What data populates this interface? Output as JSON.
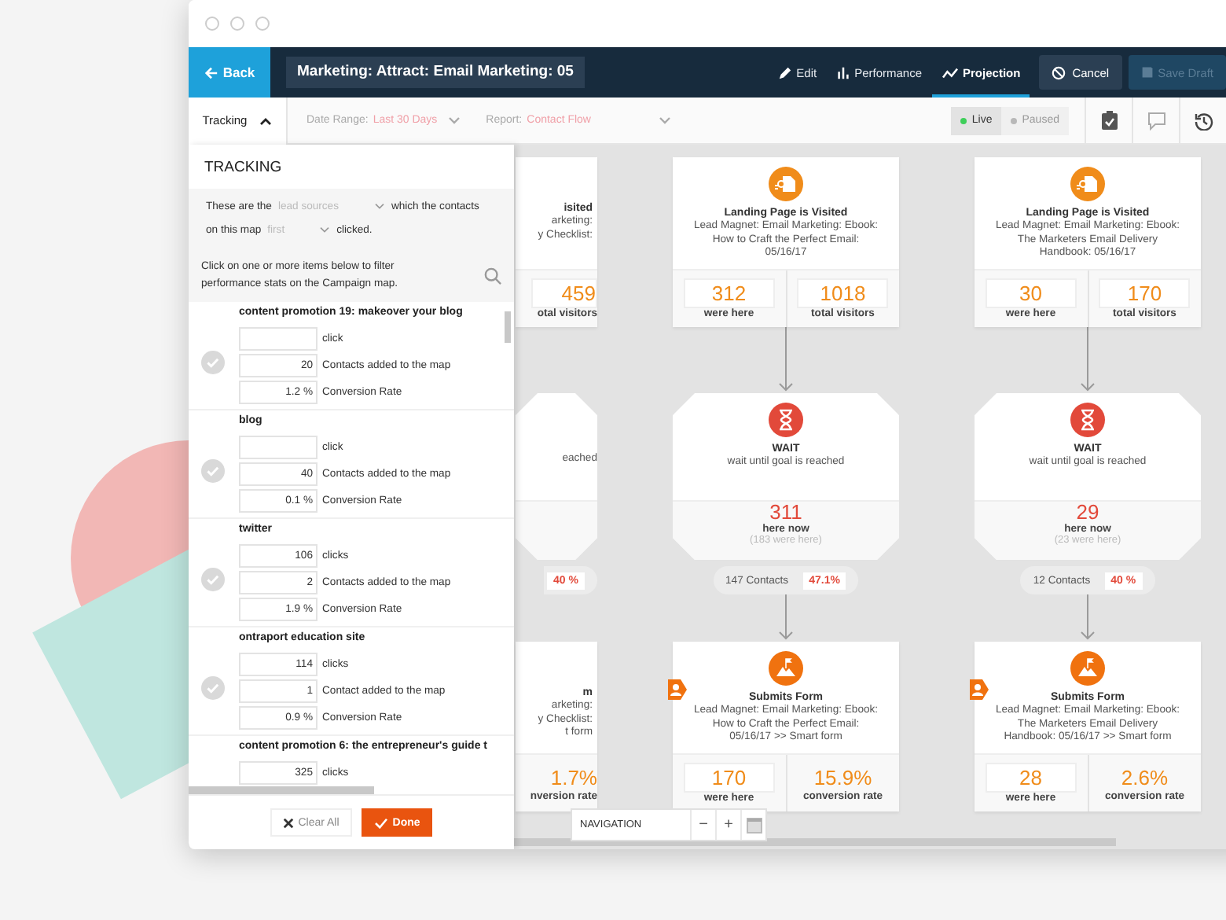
{
  "header": {
    "back": "Back",
    "title": "Marketing: Attract: Email Marketing: 05",
    "views": [
      {
        "kind": "edit",
        "label": "Edit",
        "selected": false
      },
      {
        "kind": "performance",
        "label": "Performance",
        "selected": false
      },
      {
        "kind": "projection",
        "label": "Projection",
        "selected": true
      }
    ],
    "cancel": "Cancel",
    "save_draft": {
      "label": "Save Draft",
      "disabled": true
    }
  },
  "toolbar": {
    "tracking": {
      "label": "Tracking",
      "expanded": true
    },
    "date_range": {
      "label": "Date Range:",
      "value": "Last 30 Days"
    },
    "report": {
      "label": "Report:",
      "value": "Contact Flow"
    },
    "modes": [
      {
        "kind": "live",
        "label": "Live",
        "selected": true
      },
      {
        "kind": "paused",
        "label": "Paused",
        "selected": false
      }
    ]
  },
  "tracking_panel": {
    "title": "TRACKING",
    "filter": {
      "text_1": "These are the",
      "source": "lead sources",
      "text_2": "which the contacts",
      "text_3": "on this map",
      "order": "first",
      "text_4": "clicked."
    },
    "hint": "Click on one or more items below to filter performance stats on the Campaign map.",
    "items": [
      {
        "name": "content promotion 19: makeover your blog",
        "checked": false,
        "stats": [
          {
            "label": "click"
          },
          {
            "value": "20",
            "label": "Contacts added to the map"
          },
          {
            "value": "1.2 %",
            "label": "Conversion Rate"
          }
        ]
      },
      {
        "name": "blog",
        "checked": false,
        "stats": [
          {
            "label": "click"
          },
          {
            "value": "40",
            "label": "Contacts added to the map"
          },
          {
            "value": "0.1 %",
            "label": "Conversion Rate"
          }
        ]
      },
      {
        "name": "twitter",
        "checked": false,
        "stats": [
          {
            "value": "106",
            "label": "clicks"
          },
          {
            "value": "2",
            "label": "Contacts added to the map"
          },
          {
            "value": "1.9 %",
            "label": "Conversion Rate"
          }
        ]
      },
      {
        "name": "ontraport education site",
        "checked": false,
        "stats": [
          {
            "value": "114",
            "label": "clicks"
          },
          {
            "value": "1",
            "label": "Contact added to the map"
          },
          {
            "value": "0.9 %",
            "label": "Conversion Rate"
          }
        ]
      },
      {
        "name": "content promotion 6: the entrepreneur's guide t",
        "stats": [
          {
            "value": "325",
            "label": "clicks"
          }
        ]
      }
    ],
    "clear": "Clear All",
    "done": "Done"
  },
  "canvas": {
    "columns": [
      {
        "partial": true,
        "visit": {
          "title": "isited",
          "description": [
            "arketing:",
            "y Checklist:"
          ],
          "stats": [
            {
              "kind": "count",
              "value": "459",
              "label": "otal visitors"
            }
          ]
        },
        "wait": {
          "description": [
            "eached"
          ]
        },
        "transition": {
          "rate": "40 %"
        },
        "form": {
          "title": "m",
          "description": [
            "arketing:",
            "y Checklist:",
            "t form"
          ],
          "stats": [
            {
              "kind": "rate",
              "value": "1.7%",
              "label": "nversion rate"
            }
          ]
        }
      },
      {
        "partial": false,
        "visit": {
          "title": "Landing Page is Visited",
          "description": [
            "Lead Magnet: Email Marketing: Ebook:",
            "How to Craft the Perfect Email:",
            "05/16/17"
          ],
          "stats": [
            {
              "kind": "count",
              "value": "312",
              "label": "were here"
            },
            {
              "kind": "count",
              "value": "1018",
              "label": "total visitors"
            }
          ]
        },
        "wait": {
          "title": "WAIT",
          "description": [
            "wait until goal is reached"
          ],
          "count": "311",
          "count_label": "here now",
          "history": "(183 were here)"
        },
        "transition": {
          "contacts": "147 Contacts",
          "rate": "47.1%"
        },
        "form": {
          "title": "Submits Form",
          "description": [
            "Lead Magnet: Email Marketing: Ebook:",
            "How to Craft the Perfect Email:",
            "05/16/17 >> Smart form"
          ],
          "stats": [
            {
              "kind": "count",
              "value": "170",
              "label": "were here"
            },
            {
              "kind": "rate",
              "value": "15.9%",
              "label": "conversion rate"
            }
          ]
        }
      },
      {
        "partial": false,
        "visit": {
          "title": "Landing Page is Visited",
          "description": [
            "Lead Magnet: Email Marketing: Ebook:",
            "The Marketers Email Delivery",
            "Handbook: 05/16/17"
          ],
          "stats": [
            {
              "kind": "count",
              "value": "30",
              "label": "were here"
            },
            {
              "kind": "count",
              "value": "170",
              "label": "total visitors"
            }
          ]
        },
        "wait": {
          "title": "WAIT",
          "description": [
            "wait until goal is reached"
          ],
          "count": "29",
          "count_label": "here now",
          "history": "(23 were here)"
        },
        "transition": {
          "contacts": "12 Contacts",
          "rate": "40 %"
        },
        "form": {
          "title": "Submits Form",
          "description": [
            "Lead Magnet: Email Marketing: Ebook:",
            "The Marketers Email Delivery",
            "Handbook: 05/16/17 >> Smart form"
          ],
          "stats": [
            {
              "kind": "count",
              "value": "28",
              "label": "were here"
            },
            {
              "kind": "rate",
              "value": "2.6%",
              "label": "conversion rate"
            }
          ]
        }
      }
    ],
    "navigation": {
      "label": "NAVIGATION",
      "zoom_out": "−",
      "zoom_in": "+"
    }
  }
}
